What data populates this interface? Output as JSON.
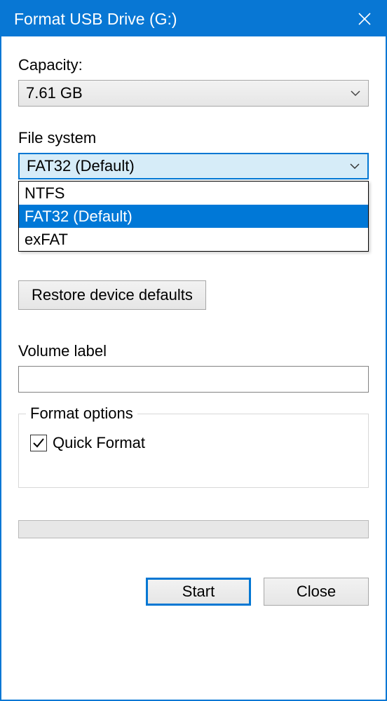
{
  "title": "Format USB Drive (G:)",
  "capacity": {
    "label": "Capacity:",
    "value": "7.61 GB"
  },
  "filesystem": {
    "label": "File system",
    "value": "FAT32 (Default)",
    "options": [
      "NTFS",
      "FAT32 (Default)",
      "exFAT"
    ]
  },
  "restore_label": "Restore device defaults",
  "volume": {
    "label": "Volume label",
    "value": ""
  },
  "format_options": {
    "title": "Format options",
    "quick_format_label": "Quick Format",
    "quick_format_checked": true
  },
  "buttons": {
    "start": "Start",
    "close": "Close"
  }
}
